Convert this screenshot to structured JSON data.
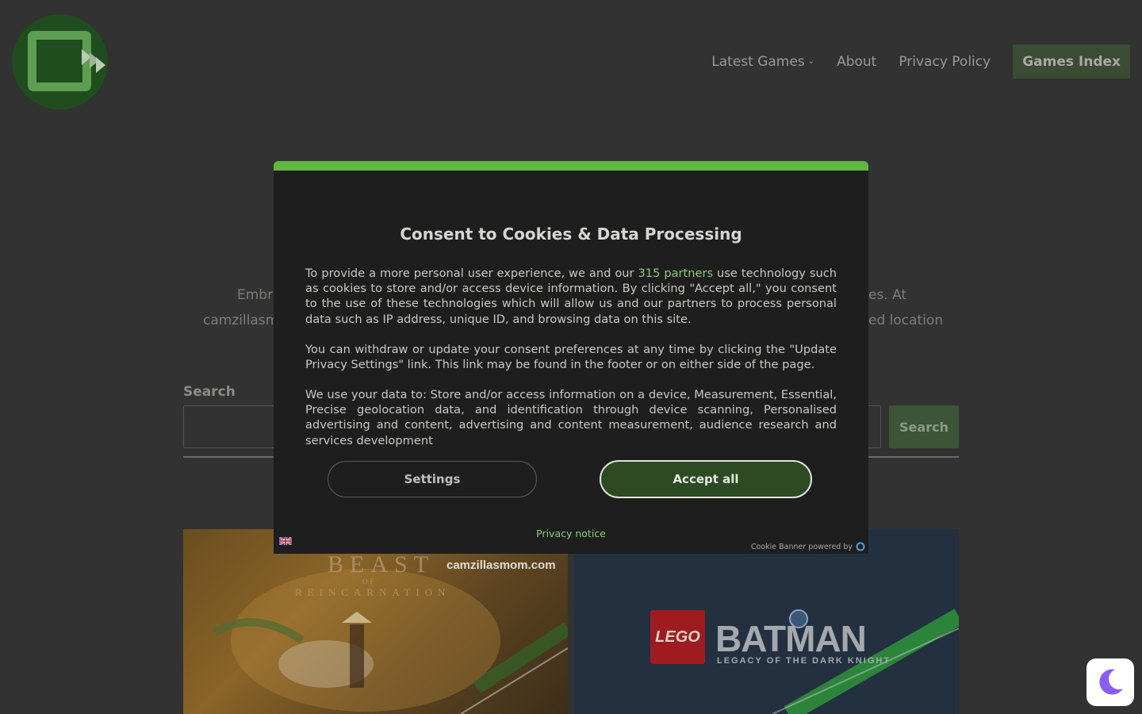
{
  "header": {
    "nav": [
      {
        "label": "Latest Games",
        "has_submenu": true
      },
      {
        "label": "About"
      },
      {
        "label": "Privacy Policy"
      }
    ],
    "cta_label": "Games Index"
  },
  "intro": {
    "line1_left": "Embra",
    "line1_right": "es. At",
    "line2_left": "camzillasm",
    "line2_right": "ed location"
  },
  "search": {
    "label": "Search",
    "button_label": "Search",
    "value": ""
  },
  "cards": [
    {
      "watermark": "camzillasmom.com",
      "title": "BEAST",
      "of": "OF",
      "subtitle": "REINCARNATION"
    },
    {
      "brand": "LEGO",
      "title": "BATMAN",
      "subtitle": "LEGACY OF THE DARK KNIGHT"
    }
  ],
  "consent": {
    "title": "Consent to Cookies & Data Processing",
    "p1_before": "To provide a more personal user experience, we and our ",
    "p1_link": "315 partners",
    "p1_after": " use technology such as cookies to store and/or access device information. By clicking \"Accept all,\" you consent to the use of these technologies which will allow us and our partners to process personal data such as IP address, unique ID, and browsing data on this site.",
    "p2": "You can withdraw or update your consent preferences at any time by clicking the \"Update Privacy Settings\" link. This link may be found in the footer or on either side of the page.",
    "p3": "We use your data to: Store and/or access information on a device, Measurement, Essential, Precise geolocation data, and identification through device scanning, Personalised advertising and content, advertising and content measurement, audience research and services development",
    "settings_label": "Settings",
    "accept_label": "Accept all",
    "privacy_notice": "Privacy notice",
    "powered_by": "Cookie Banner powered by"
  },
  "colors": {
    "accent_green": "#5fb73f",
    "link_green": "#8cc97a",
    "accept_bg": "#2c4b22",
    "moon_purple": "#8b5cf6"
  }
}
